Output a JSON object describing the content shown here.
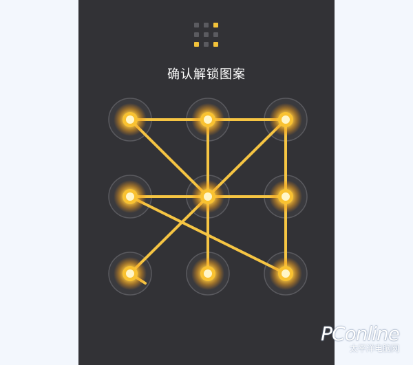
{
  "screen": {
    "title": "确认解锁图案"
  },
  "indicator": {
    "cells": [
      false,
      false,
      true,
      false,
      false,
      false,
      true,
      false,
      true
    ],
    "on_color": "#f2c23a",
    "off_color": "#5b5b60"
  },
  "pattern": {
    "sequence": [
      7,
      5,
      1,
      3,
      9,
      4,
      6,
      3,
      5,
      8,
      2
    ],
    "active_color": "#f9c231",
    "line_color": "#f6c543"
  },
  "watermark": {
    "brand": "PConline",
    "sub": "太平洋电脑网"
  }
}
